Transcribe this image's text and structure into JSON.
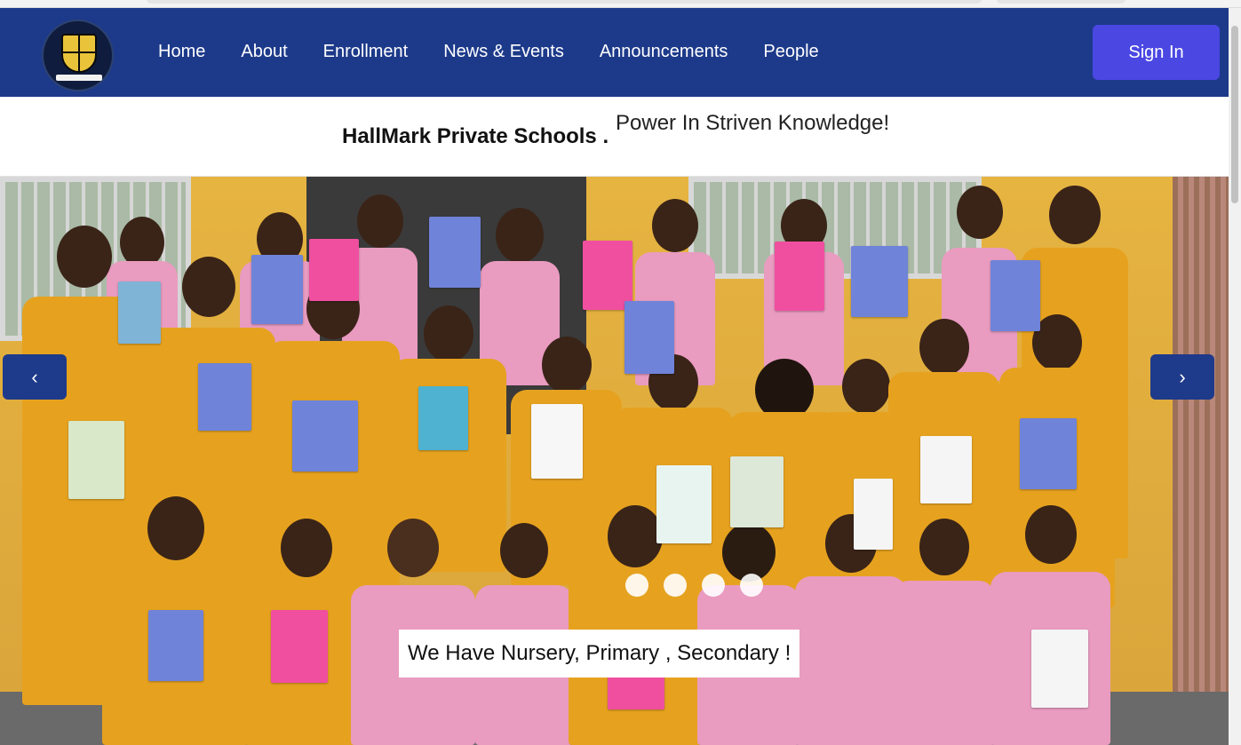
{
  "nav": {
    "links": [
      "Home",
      "About",
      "Enrollment",
      "News & Events",
      "Announcements",
      "People"
    ],
    "signin_label": "Sign In"
  },
  "header": {
    "school_name": "HallMark Private Schools .",
    "motto": "Power In Striven Knowledge!"
  },
  "carousel": {
    "caption": "We Have Nursery, Primary , Secondary !",
    "prev_label": "‹",
    "next_label": "›",
    "slide_count": 4
  },
  "colors": {
    "navbar": "#1d3a8a",
    "signin": "#4a47e3",
    "uniform_yellow": "#e6a21f",
    "uniform_pink": "#e99bc0"
  }
}
